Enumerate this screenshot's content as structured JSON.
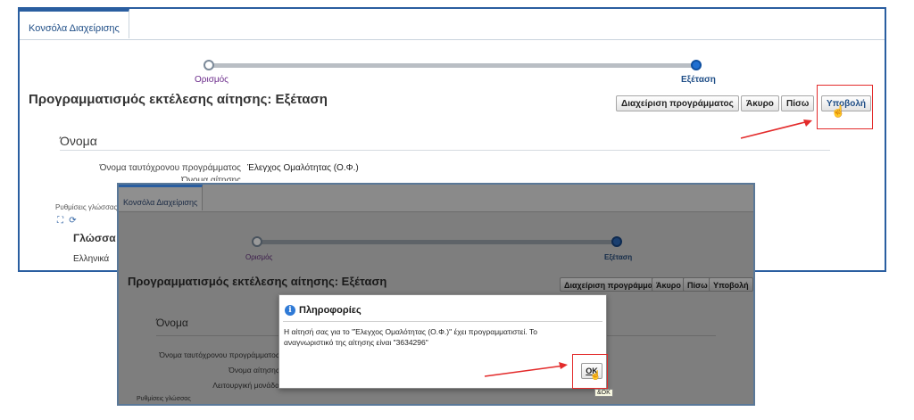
{
  "console_tab": "Κονσόλα Διαχείρισης",
  "train": {
    "step1": "Ορισμός",
    "step2": "Εξέταση"
  },
  "page_title": "Προγραμματισμός εκτέλεσης αίτησης: Εξέταση",
  "buttons": {
    "manage_schedule": "Διαχείριση προγράμματος",
    "cancel": "Άκυρο",
    "back": "Πίσω",
    "submit": "Υποβολή"
  },
  "section": {
    "name_heading": "Όνομα"
  },
  "fields": {
    "program_name_label": "Όνομα ταυτόχρονου προγράμματος",
    "program_name_value": "Έλεγχος Ομαλότητας (Ο.Φ.)",
    "request_name_label": "Όνομα αίτησης",
    "operating_unit_label": "Λειτουργική μονάδα",
    "settings_label": "Ρυθμίσεις γλώσσας"
  },
  "language_section": {
    "heading": "Γλώσσα",
    "value": "Ελληνικά"
  },
  "dialog": {
    "title": "Πληροφορίες",
    "message": "Η αίτησή σας για το \"Έλεγχος Ομαλότητας (Ο.Φ.)\" έχει προγραμματιστεί. Το αναγνωριστικό της αίτησης είναι \"3634296\"",
    "ok": "OK",
    "ok_tooltip": "&OK"
  },
  "colors": {
    "highlight": "#e32b2b",
    "accent": "#2a5ea0"
  }
}
